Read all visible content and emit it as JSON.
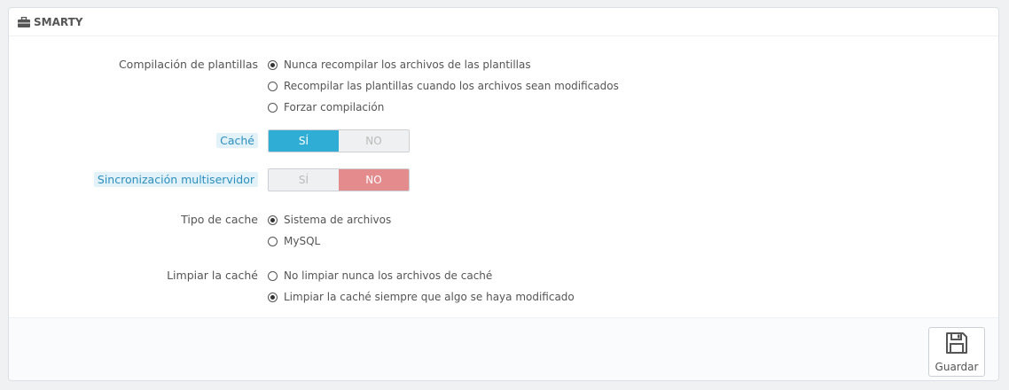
{
  "panel": {
    "title": "SMARTY"
  },
  "template_compilation": {
    "label": "Compilación de plantillas",
    "options": [
      {
        "label": "Nunca recompilar los archivos de las plantillas",
        "checked": true
      },
      {
        "label": "Recompilar las plantillas cuando los archivos sean modificados",
        "checked": false
      },
      {
        "label": "Forzar compilación",
        "checked": false
      }
    ]
  },
  "cache": {
    "label": "Caché",
    "yes": "SÍ",
    "no": "NO",
    "value": "yes"
  },
  "multiserver_sync": {
    "label": "Sincronización multiservidor",
    "yes": "SÍ",
    "no": "NO",
    "value": "no"
  },
  "cache_type": {
    "label": "Tipo de cache",
    "options": [
      {
        "label": "Sistema de archivos",
        "checked": true
      },
      {
        "label": "MySQL",
        "checked": false
      }
    ]
  },
  "clear_cache": {
    "label": "Limpiar la caché",
    "options": [
      {
        "label": "No limpiar nunca los archivos de caché",
        "checked": false
      },
      {
        "label": "Limpiar la caché siempre que algo se haya modificado",
        "checked": true
      }
    ]
  },
  "footer": {
    "save_label": "Guardar"
  },
  "colors": {
    "switch_yes": "#2fadd4",
    "switch_no": "#e38b8d",
    "hint_label": "#2a8fbd"
  }
}
